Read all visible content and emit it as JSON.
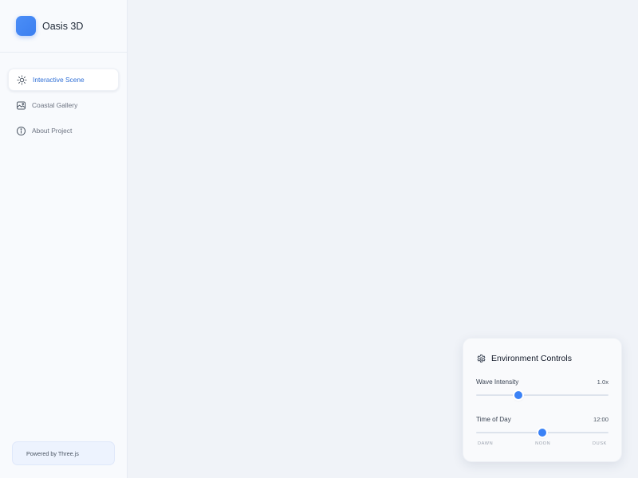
{
  "app": {
    "name": "Oasis 3D",
    "accent_color": "#3b82f6"
  },
  "sidebar": {
    "items": [
      {
        "label": "Interactive Scene",
        "icon": "sun-icon",
        "active": true
      },
      {
        "label": "Coastal Gallery",
        "icon": "image-icon",
        "active": false
      },
      {
        "label": "About Project",
        "icon": "info-icon",
        "active": false
      }
    ],
    "footer": "Powered by Three.js"
  },
  "controls": {
    "title": "Environment Controls",
    "icon": "gear-icon",
    "wave": {
      "label": "Wave Intensity",
      "value_text": "1.0x",
      "fraction": 0.32
    },
    "time": {
      "label": "Time of Day",
      "value_text": "12:00",
      "fraction": 0.5,
      "ticks": [
        "DAWN",
        "NOON",
        "DUSK"
      ]
    }
  }
}
